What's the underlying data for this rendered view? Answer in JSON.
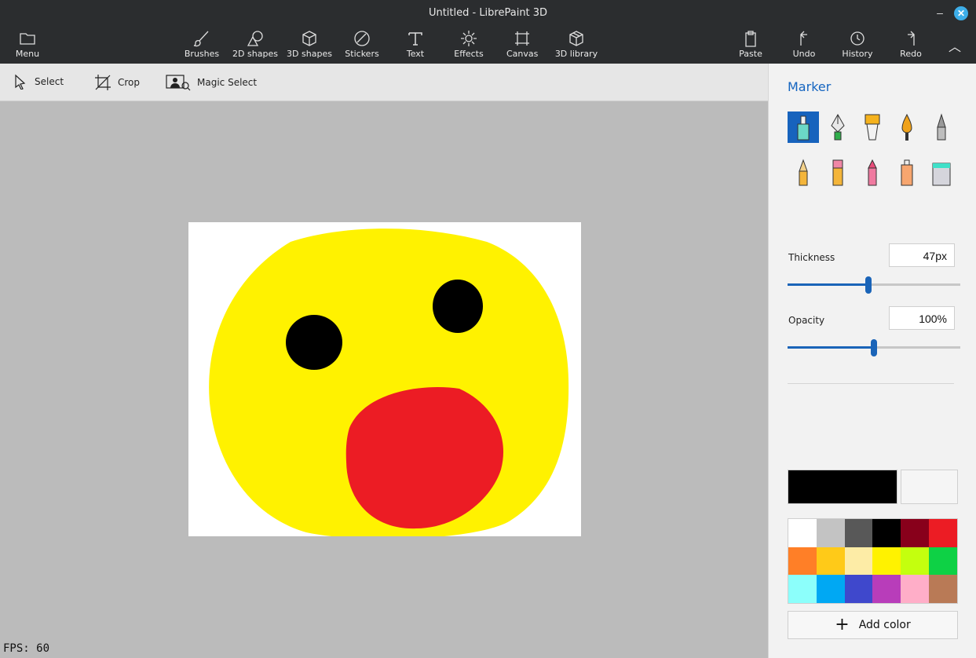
{
  "window": {
    "title": "Untitled - LibrePaint 3D",
    "minimize_glyph": "–",
    "close_glyph": "✕"
  },
  "toolbar": {
    "menu": "Menu",
    "brushes": "Brushes",
    "shapes2d": "2D shapes",
    "shapes3d": "3D shapes",
    "stickers": "Stickers",
    "text": "Text",
    "effects": "Effects",
    "canvas": "Canvas",
    "library3d": "3D library",
    "paste": "Paste",
    "undo": "Undo",
    "history": "History",
    "redo": "Redo",
    "collapse_glyph": "︿"
  },
  "subtoolbar": {
    "select": "Select",
    "crop": "Crop",
    "magic_select": "Magic Select"
  },
  "status": {
    "fps": "FPS: 60"
  },
  "panel": {
    "title": "Marker",
    "selected_brush": "marker",
    "brushes": [
      "marker",
      "calligraphy-pen",
      "oil-brush",
      "watercolor",
      "pixel-pen",
      "pencil",
      "eraser",
      "crayon",
      "spray-can",
      "fill"
    ],
    "thickness": {
      "label": "Thickness",
      "value": "47px",
      "fraction": 0.47
    },
    "opacity": {
      "label": "Opacity",
      "value": "100%",
      "fraction": 0.5
    },
    "primary_color": "#000000",
    "secondary_color": "#f5f5f5",
    "palette": [
      "#ffffff",
      "#c3c3c3",
      "#585858",
      "#000000",
      "#88001b",
      "#ec1c24",
      "#ff7f27",
      "#ffca18",
      "#fdeca6",
      "#fff200",
      "#c4ff0e",
      "#0ed145",
      "#8cfffb",
      "#00a8f3",
      "#3f48cc",
      "#b83dba",
      "#ffaec8",
      "#b97a56"
    ],
    "add_color": "Add color",
    "add_color_glyph": "+"
  },
  "drawing": {
    "background": "#ffffff",
    "face_color": "#fff200",
    "eye_color": "#000000",
    "mouth_color": "#ec1c24"
  }
}
